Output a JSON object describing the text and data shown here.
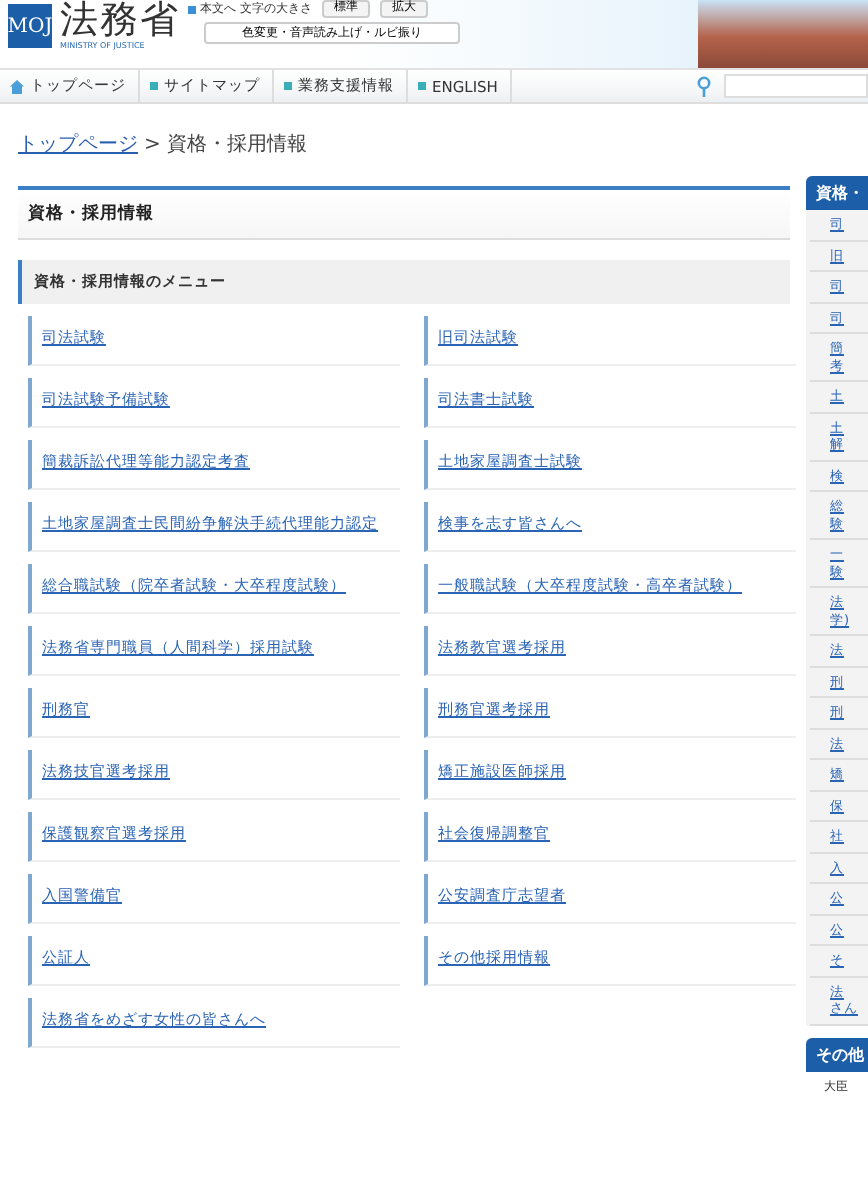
{
  "header": {
    "logo_mark": "MOJ",
    "title": "法務省",
    "subtitle": "MINISTRY OF JUSTICE",
    "skip_link": "本文へ",
    "font_size_label": "文字の大きさ",
    "font_buttons": [
      "標準",
      "拡大"
    ],
    "accessibility_button": "色変更・音声読み上げ・ルビ振り"
  },
  "nav": [
    {
      "label": "トップページ",
      "kind": "home"
    },
    {
      "label": "サイトマップ",
      "kind": "link"
    },
    {
      "label": "業務支援情報",
      "kind": "link"
    },
    {
      "label": "ENGLISH",
      "kind": "link"
    }
  ],
  "breadcrumb": {
    "link": "トップページ",
    "separator": ">",
    "current": "資格・採用情報"
  },
  "page_title": "資格・採用情報",
  "menu_title": "資格・採用情報のメニュー",
  "menu_links": [
    "司法試験",
    "旧司法試験",
    "司法試験予備試験",
    "司法書士試験",
    "簡裁訴訟代理等能力認定考査",
    "土地家屋調査士試験",
    "土地家屋調査士民間紛争解決手続代理能力認定",
    "検事を志す皆さんへ",
    "総合職試験（院卒者試験・大卒程度試験）",
    "一般職試験（大卒程度試験・高卒者試験）",
    "法務省専門職員（人間科学）採用試験",
    "法務教官選考採用",
    "刑務官",
    "刑務官選考採用",
    "法務技官選考採用",
    "矯正施設医師採用",
    "保護観察官選考採用",
    "社会復帰調整官",
    "入国警備官",
    "公安調査庁志望者",
    "公証人",
    "その他採用情報",
    "法務省をめざす女性の皆さんへ"
  ],
  "sidebar": {
    "title": "資格・",
    "items": [
      [
        "司"
      ],
      [
        "旧"
      ],
      [
        "司"
      ],
      [
        "司"
      ],
      [
        "簡",
        "考"
      ],
      [
        "土"
      ],
      [
        "土",
        "解"
      ],
      [
        "検"
      ],
      [
        "総",
        "験"
      ],
      [
        "一",
        "験"
      ],
      [
        "法",
        "学)"
      ],
      [
        "法"
      ],
      [
        "刑"
      ],
      [
        "刑"
      ],
      [
        "法"
      ],
      [
        "矯"
      ],
      [
        "保"
      ],
      [
        "社"
      ],
      [
        "入"
      ],
      [
        "公"
      ],
      [
        "公"
      ],
      [
        "そ"
      ],
      [
        "法",
        "さん"
      ]
    ],
    "other_title": "その他",
    "other_item": "大臣"
  }
}
